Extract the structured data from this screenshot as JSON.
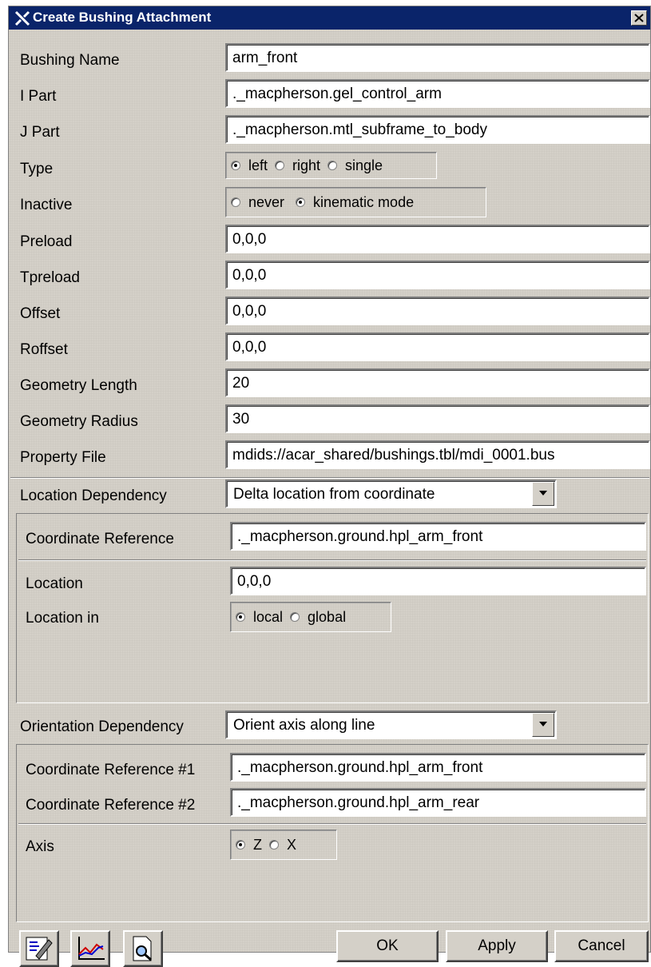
{
  "window": {
    "title": "Create Bushing Attachment",
    "close_icon": "close-icon",
    "app_icon": "adams-x-icon"
  },
  "fields": {
    "bushing_name": {
      "label": "Bushing Name",
      "value": "arm_front"
    },
    "i_part": {
      "label": "I Part",
      "value": "._macpherson.gel_control_arm"
    },
    "j_part": {
      "label": "J Part",
      "value": "._macpherson.mtl_subframe_to_body"
    },
    "preload": {
      "label": "Preload",
      "value": "0,0,0"
    },
    "tpreload": {
      "label": "Tpreload",
      "value": "0,0,0"
    },
    "offset": {
      "label": "Offset",
      "value": "0,0,0"
    },
    "roffset": {
      "label": "Roffset",
      "value": "0,0,0"
    },
    "geometry_length": {
      "label": "Geometry Length",
      "value": "20"
    },
    "geometry_radius": {
      "label": "Geometry Radius",
      "value": "30"
    },
    "property_file": {
      "label": "Property File",
      "value": "mdids://acar_shared/bushings.tbl/mdi_0001.bus"
    }
  },
  "type": {
    "label": "Type",
    "options": [
      "left",
      "right",
      "single"
    ],
    "selected": "left"
  },
  "inactive": {
    "label": "Inactive",
    "options": [
      "never",
      "kinematic mode"
    ],
    "selected": "kinematic mode"
  },
  "location_dependency": {
    "label": "Location Dependency",
    "value": "Delta location from coordinate",
    "coordinate_reference": {
      "label": "Coordinate Reference",
      "value": "._macpherson.ground.hpl_arm_front"
    },
    "location": {
      "label": "Location",
      "value": "0,0,0"
    },
    "location_in": {
      "label": "Location in",
      "options": [
        "local",
        "global"
      ],
      "selected": "local"
    }
  },
  "orientation_dependency": {
    "label": "Orientation Dependency",
    "value": "Orient axis along line",
    "coord_ref_1": {
      "label": "Coordinate Reference #1",
      "value": "._macpherson.ground.hpl_arm_front"
    },
    "coord_ref_2": {
      "label": "Coordinate Reference #2",
      "value": "._macpherson.ground.hpl_arm_rear"
    },
    "axis": {
      "label": "Axis",
      "options": [
        "Z",
        "X"
      ],
      "selected": "Z"
    }
  },
  "buttons": {
    "ok": "OK",
    "apply": "Apply",
    "cancel": "Cancel"
  },
  "tool_icons": [
    "notes-edit-icon",
    "plot-curves-icon",
    "file-browse-icon"
  ]
}
